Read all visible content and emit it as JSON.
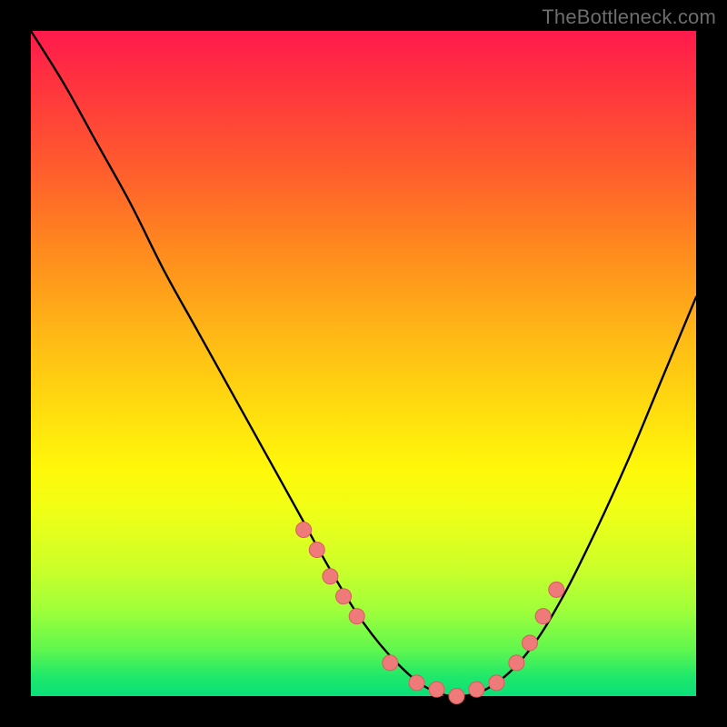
{
  "watermark": "TheBottleneck.com",
  "colors": {
    "curve_stroke": "#000000",
    "marker_fill": "#ee7a7a",
    "marker_stroke": "#d85c5c",
    "background": "#000000"
  },
  "chart_data": {
    "type": "line",
    "title": "",
    "xlabel": "",
    "ylabel": "",
    "xlim": [
      0,
      100
    ],
    "ylim": [
      0,
      100
    ],
    "grid": false,
    "legend": false,
    "series": [
      {
        "name": "bottleneck-curve",
        "x": [
          0,
          5,
          10,
          15,
          20,
          25,
          30,
          35,
          40,
          45,
          50,
          55,
          60,
          65,
          70,
          75,
          80,
          85,
          90,
          95,
          100
        ],
        "y": [
          100,
          92,
          83,
          74,
          64,
          55,
          46,
          37,
          28,
          19,
          11,
          5,
          1,
          0,
          2,
          7,
          15,
          25,
          36,
          48,
          60
        ]
      }
    ],
    "markers": {
      "name": "highlight-points",
      "x": [
        41,
        43,
        45,
        47,
        49,
        54,
        58,
        61,
        64,
        67,
        70,
        73,
        75,
        77,
        79
      ],
      "y": [
        25,
        22,
        18,
        15,
        12,
        5,
        2,
        1,
        0,
        1,
        2,
        5,
        8,
        12,
        16
      ]
    }
  }
}
